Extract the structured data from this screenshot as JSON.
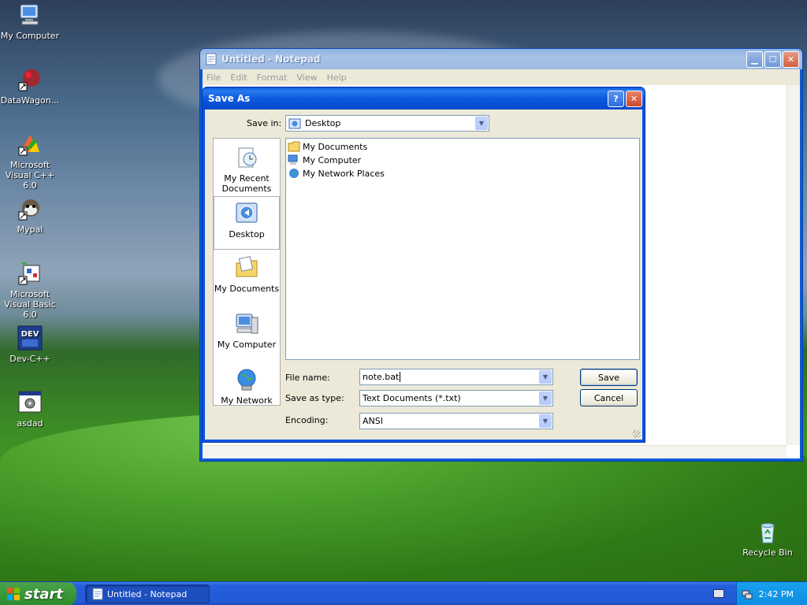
{
  "desktop": {
    "icons": [
      {
        "label": "My Computer"
      },
      {
        "label": "DataWagon..."
      },
      {
        "label": "Microsoft Visual C++ 6.0"
      },
      {
        "label": "Mypal"
      },
      {
        "label": "Microsoft Visual Basic 6.0"
      },
      {
        "label": "Dev-C++"
      },
      {
        "label": "asdad"
      },
      {
        "label": "Recycle Bin"
      }
    ]
  },
  "notepad": {
    "title": "Untitled - Notepad",
    "menu": [
      "File",
      "Edit",
      "Format",
      "View",
      "Help"
    ]
  },
  "dialog": {
    "title": "Save As",
    "save_in_label": "Save in:",
    "save_in_value": "Desktop",
    "places": [
      "My Recent Documents",
      "Desktop",
      "My Documents",
      "My Computer",
      "My Network"
    ],
    "selected_place": "Desktop",
    "files": [
      "My Documents",
      "My Computer",
      "My Network Places"
    ],
    "file_name_label": "File name:",
    "file_name_value": "note.bat",
    "save_type_label": "Save as type:",
    "save_type_value": "Text Documents (*.txt)",
    "encoding_label": "Encoding:",
    "encoding_value": "ANSI",
    "save_button": "Save",
    "cancel_button": "Cancel"
  },
  "taskbar": {
    "start_label": "start",
    "task_label": "Untitled - Notepad",
    "clock": "2:42 PM"
  },
  "colors": {
    "title_active": "#0054e3",
    "taskbar": "#245edb",
    "start": "#3c9b3c"
  }
}
